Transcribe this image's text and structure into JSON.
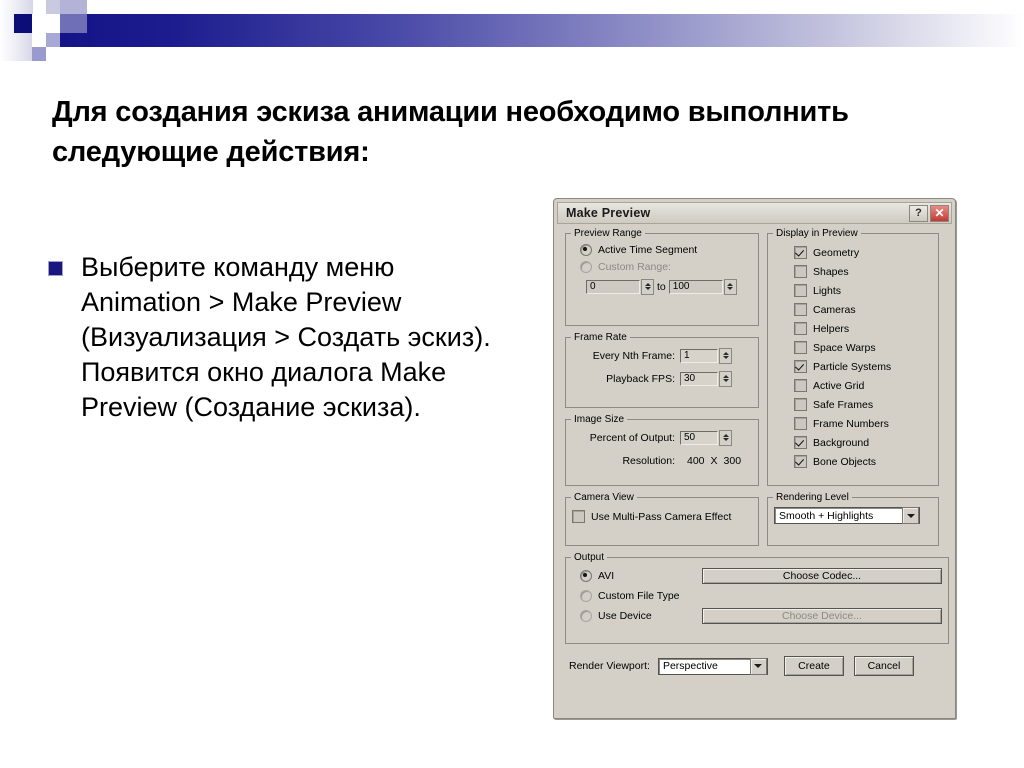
{
  "slide": {
    "title": "Для создания эскиза анимации необходимо выполнить следующие действия:",
    "bullet_text": "Выберите команду меню Animation > Make Preview (Визуализация > Создать эскиз). Появится окно диалога Make Preview (Создание эскиза).",
    "bullet_marker_color": "#17177e",
    "banner_color_dark": "#141488"
  },
  "dialog": {
    "title": "Make Preview",
    "help_button": "?",
    "close_button": "✕",
    "preview_range": {
      "legend": "Preview Range",
      "active_time_segment": "Active Time Segment",
      "custom_range": "Custom Range:",
      "from_value": "0",
      "to_label": "to",
      "to_value": "100",
      "selected": "Active Time Segment"
    },
    "frame_rate": {
      "legend": "Frame Rate",
      "every_nth_frame_label": "Every Nth Frame:",
      "every_nth_frame_value": "1",
      "playback_fps_label": "Playback FPS:",
      "playback_fps_value": "30"
    },
    "image_size": {
      "legend": "Image Size",
      "percent_label": "Percent of Output:",
      "percent_value": "50",
      "resolution_label": "Resolution:",
      "resolution_width": "400",
      "resolution_sep": "X",
      "resolution_height": "300"
    },
    "display_in_preview": {
      "legend": "Display in Preview",
      "items": [
        {
          "label": "Geometry",
          "checked": true
        },
        {
          "label": "Shapes",
          "checked": false
        },
        {
          "label": "Lights",
          "checked": false
        },
        {
          "label": "Cameras",
          "checked": false
        },
        {
          "label": "Helpers",
          "checked": false
        },
        {
          "label": "Space Warps",
          "checked": false
        },
        {
          "label": "Particle Systems",
          "checked": true
        },
        {
          "label": "Active Grid",
          "checked": false
        },
        {
          "label": "Safe Frames",
          "checked": false
        },
        {
          "label": "Frame Numbers",
          "checked": false
        },
        {
          "label": "Background",
          "checked": true
        },
        {
          "label": "Bone Objects",
          "checked": true
        }
      ]
    },
    "camera_view": {
      "legend": "Camera View",
      "multipass_label": "Use Multi-Pass Camera Effect",
      "multipass_checked": false
    },
    "rendering_level": {
      "legend": "Rendering Level",
      "value": "Smooth + Highlights"
    },
    "output": {
      "legend": "Output",
      "avi_label": "AVI",
      "choose_codec_label": "Choose Codec...",
      "custom_file_type_label": "Custom File Type",
      "use_device_label": "Use Device",
      "choose_device_label": "Choose Device...",
      "selected": "AVI"
    },
    "footer": {
      "render_viewport_label": "Render Viewport:",
      "render_viewport_value": "Perspective",
      "create_label": "Create",
      "cancel_label": "Cancel"
    }
  }
}
